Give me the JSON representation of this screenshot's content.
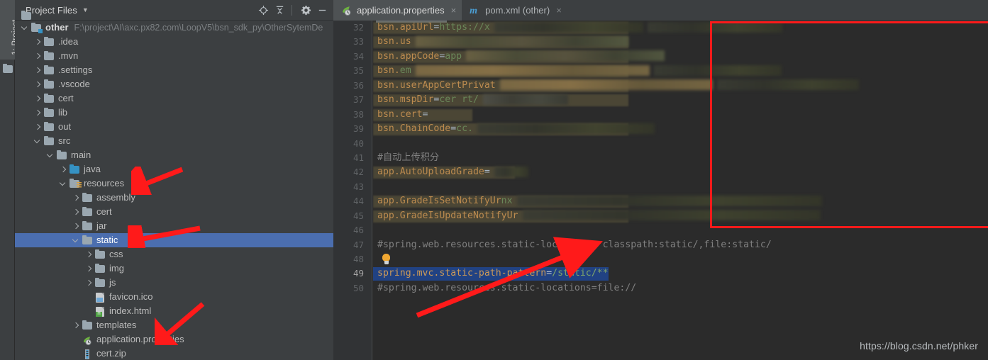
{
  "window": {
    "left_stripe_tab": "1: Project",
    "watermark": "https://blog.csdn.net/phker"
  },
  "project_panel": {
    "title": "Project Files",
    "caret": "▼",
    "toolbar": [
      {
        "name": "locate-icon",
        "tooltip": "Select Opened File"
      },
      {
        "name": "collapse-all-icon",
        "tooltip": "Collapse All"
      },
      {
        "name": "gear-icon",
        "tooltip": "Settings"
      },
      {
        "name": "minimize-icon",
        "tooltip": "Hide"
      }
    ],
    "tree": [
      {
        "label": "other",
        "path": "F:\\project\\AI\\axc.px82.com\\LoopV5\\bsn_sdk_py\\OtherSytemDe",
        "indent": 0,
        "arrow": "down",
        "icon": "module-folder",
        "bold": true,
        "selected": false
      },
      {
        "label": ".idea",
        "path": "",
        "indent": 1,
        "arrow": "right",
        "icon": "folder",
        "bold": false,
        "selected": false
      },
      {
        "label": ".mvn",
        "path": "",
        "indent": 1,
        "arrow": "right",
        "icon": "folder",
        "bold": false,
        "selected": false
      },
      {
        "label": ".settings",
        "path": "",
        "indent": 1,
        "arrow": "right",
        "icon": "folder",
        "bold": false,
        "selected": false
      },
      {
        "label": ".vscode",
        "path": "",
        "indent": 1,
        "arrow": "right",
        "icon": "folder",
        "bold": false,
        "selected": false
      },
      {
        "label": "cert",
        "path": "",
        "indent": 1,
        "arrow": "right",
        "icon": "folder",
        "bold": false,
        "selected": false
      },
      {
        "label": "lib",
        "path": "",
        "indent": 1,
        "arrow": "right",
        "icon": "folder",
        "bold": false,
        "selected": false
      },
      {
        "label": "out",
        "path": "",
        "indent": 1,
        "arrow": "right",
        "icon": "folder",
        "bold": false,
        "selected": false
      },
      {
        "label": "src",
        "path": "",
        "indent": 1,
        "arrow": "down",
        "icon": "folder",
        "bold": false,
        "selected": false
      },
      {
        "label": "main",
        "path": "",
        "indent": 2,
        "arrow": "down",
        "icon": "folder",
        "bold": false,
        "selected": false
      },
      {
        "label": "java",
        "path": "",
        "indent": 3,
        "arrow": "right",
        "icon": "source-folder",
        "bold": false,
        "selected": false
      },
      {
        "label": "resources",
        "path": "",
        "indent": 3,
        "arrow": "down",
        "icon": "resources-folder",
        "bold": false,
        "selected": false
      },
      {
        "label": "assembly",
        "path": "",
        "indent": 4,
        "arrow": "right",
        "icon": "folder",
        "bold": false,
        "selected": false
      },
      {
        "label": "cert",
        "path": "",
        "indent": 4,
        "arrow": "right",
        "icon": "folder",
        "bold": false,
        "selected": false
      },
      {
        "label": "jar",
        "path": "",
        "indent": 4,
        "arrow": "right",
        "icon": "folder",
        "bold": false,
        "selected": false
      },
      {
        "label": "static",
        "path": "",
        "indent": 4,
        "arrow": "down",
        "icon": "folder",
        "bold": false,
        "selected": true
      },
      {
        "label": "css",
        "path": "",
        "indent": 5,
        "arrow": "right",
        "icon": "folder",
        "bold": false,
        "selected": false
      },
      {
        "label": "img",
        "path": "",
        "indent": 5,
        "arrow": "right",
        "icon": "folder",
        "bold": false,
        "selected": false
      },
      {
        "label": "js",
        "path": "",
        "indent": 5,
        "arrow": "right",
        "icon": "folder",
        "bold": false,
        "selected": false
      },
      {
        "label": "favicon.ico",
        "path": "",
        "indent": 5,
        "arrow": "none",
        "icon": "image-file",
        "bold": false,
        "selected": false
      },
      {
        "label": "index.html",
        "path": "",
        "indent": 5,
        "arrow": "none",
        "icon": "html-file",
        "bold": false,
        "selected": false
      },
      {
        "label": "templates",
        "path": "",
        "indent": 4,
        "arrow": "right",
        "icon": "folder",
        "bold": false,
        "selected": false
      },
      {
        "label": "application.properties",
        "path": "",
        "indent": 4,
        "arrow": "none",
        "icon": "spring-properties-file",
        "bold": false,
        "selected": false
      },
      {
        "label": "cert.zip",
        "path": "",
        "indent": 4,
        "arrow": "none",
        "icon": "zip-file",
        "bold": false,
        "selected": false
      }
    ]
  },
  "editor": {
    "tabs": [
      {
        "label": "application.properties",
        "icon": "spring-leaf-icon",
        "active": true,
        "close": "×"
      },
      {
        "label": "pom.xml (other)",
        "icon": "maven-m-icon",
        "active": false,
        "close": "×"
      }
    ],
    "first_line_number": 32,
    "current_line": 49,
    "line_numbers": [
      32,
      33,
      34,
      35,
      36,
      37,
      38,
      39,
      40,
      41,
      42,
      43,
      44,
      45,
      46,
      47,
      48,
      49,
      50
    ],
    "lines": [
      {
        "n": 32,
        "type": "redacted",
        "key": "bsn.apiUrl",
        "eq": "=",
        "val": "https://x",
        "redacted": true
      },
      {
        "n": 33,
        "type": "redacted",
        "key": "bsn.us",
        "eq": "",
        "val": "",
        "redacted": true
      },
      {
        "n": 34,
        "type": "redacted",
        "key": "bsn.appCode",
        "eq": "=",
        "val": "app",
        "redacted": true
      },
      {
        "n": 35,
        "type": "redacted",
        "key": "bsn.",
        "eq": "",
        "val": "em",
        "redacted": true
      },
      {
        "n": 36,
        "type": "redacted",
        "key": "bsn.userAppCertPrivat",
        "eq": "",
        "val": "",
        "redacted": true
      },
      {
        "n": 37,
        "type": "redacted",
        "key": "bsn.mspDir",
        "eq": "=",
        "val": "cer      rt/",
        "redacted": true
      },
      {
        "n": 38,
        "type": "redacted",
        "key": "bsn.cert",
        "eq": "=",
        "val": "",
        "redacted": true
      },
      {
        "n": 39,
        "type": "redacted",
        "key": "bsn.ChainCode",
        "eq": "=",
        "val": "cc.",
        "redacted": true
      },
      {
        "n": 40,
        "type": "blank"
      },
      {
        "n": 41,
        "type": "comment",
        "text": "#自动上传积分"
      },
      {
        "n": 42,
        "type": "redacted",
        "key": "app.AutoUploadGrade",
        "eq": "=",
        "val": "",
        "redacted": true
      },
      {
        "n": 43,
        "type": "blank"
      },
      {
        "n": 44,
        "type": "redacted",
        "key": "app.GradeIsSetNotifyUr",
        "eq": "",
        "val": "nx",
        "redacted": true
      },
      {
        "n": 45,
        "type": "redacted",
        "key": "app.GradeIsUpdateNotifyUr",
        "eq": "",
        "val": "",
        "redacted": true
      },
      {
        "n": 46,
        "type": "blank"
      },
      {
        "n": 47,
        "type": "comment",
        "text": "#spring.web.resources.static-locations= classpath:static/,file:static/"
      },
      {
        "n": 48,
        "type": "bulb"
      },
      {
        "n": 49,
        "type": "selected",
        "key": "spring.mvc.static-path-pattern",
        "eq": "=",
        "val": "/static/**"
      },
      {
        "n": 50,
        "type": "comment",
        "text": "#spring.web.resources.static-locations=file://"
      }
    ]
  },
  "annotations": {
    "red_rect": {
      "label": "redacted-config-block-highlight"
    },
    "arrows": [
      {
        "name": "arrow-to-resources-folder"
      },
      {
        "name": "arrow-to-static-folder"
      },
      {
        "name": "arrow-to-application-properties"
      },
      {
        "name": "arrow-to-static-path-pattern"
      }
    ]
  },
  "colors": {
    "panel_bg": "#3c3f41",
    "editor_bg": "#2b2b2b",
    "gutter_bg": "#313335",
    "selection_blue": "#4b6eaf",
    "line_selection": "#214283",
    "annotation_red": "#ff1a1a",
    "key_orange": "#bc8b4f",
    "value_green": "#6a8759",
    "comment_gray": "#808080"
  }
}
